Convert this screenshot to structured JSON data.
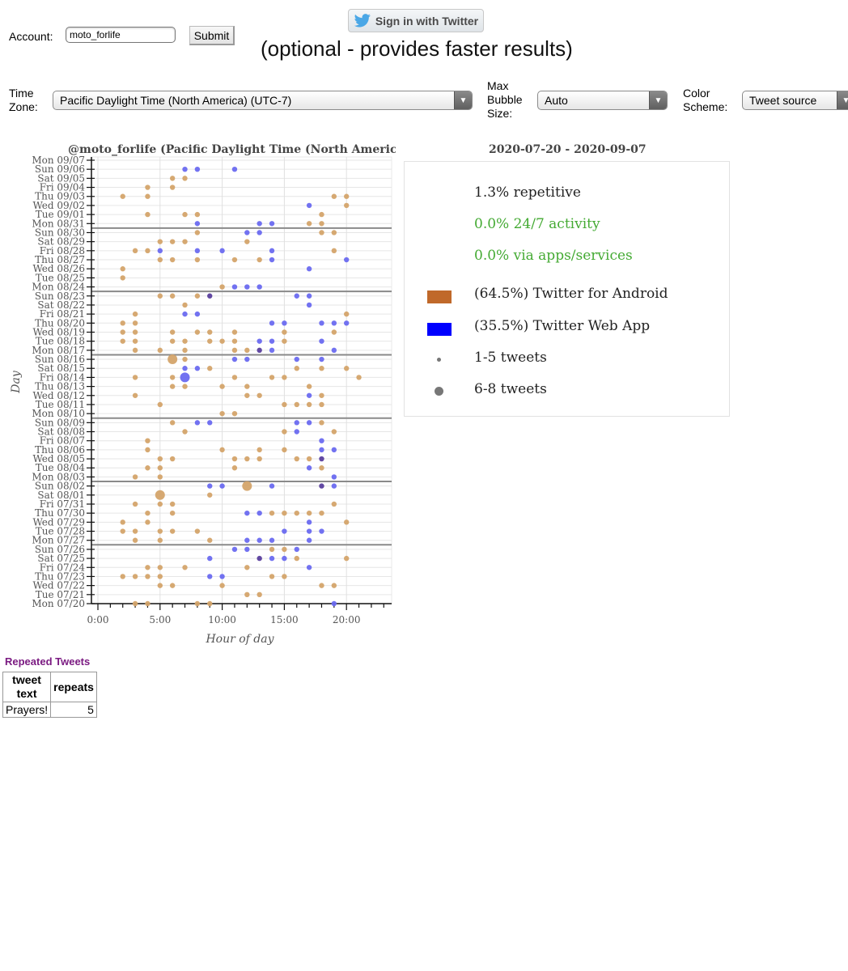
{
  "header": {
    "account_label": "Account:",
    "account_value": "moto_forlife",
    "submit_label": "Submit",
    "twitter_signin_label": "Sign in with Twitter",
    "optional_note": "(optional - provides faster results)"
  },
  "controls": {
    "timezone_label_line1": "Time",
    "timezone_label_line2": "Zone:",
    "timezone_value": "Pacific Daylight Time (North America) (UTC-7)",
    "bubble_label_line1": "Max",
    "bubble_label_line2": "Bubble",
    "bubble_label_line3": "Size:",
    "bubble_value": "Auto",
    "color_label_line1": "Color",
    "color_label_line2": "Scheme:",
    "color_value": "Tweet source"
  },
  "legend": {
    "repetitive": "1.3% repetitive",
    "activity_247": "0.0% 24/7 activity",
    "apps_services": "0.0% via apps/services",
    "source_android": "(64.5%) Twitter for Android",
    "source_web": "(35.5%) Twitter Web App",
    "size_small": "1-5 tweets",
    "size_large": "6-8 tweets",
    "colors": {
      "android": "#c0692a",
      "web": "#0000ff",
      "neutral_text": "#222222",
      "good_text": "#44aa33"
    }
  },
  "repeated": {
    "title": "Repeated Tweets",
    "headers": [
      "tweet text",
      "repeats"
    ],
    "header_text_line1": "tweet",
    "header_text_line2": "text",
    "rows": [
      {
        "text": "Prayers!",
        "repeats": "5"
      }
    ]
  },
  "chart_data": {
    "type": "scatter",
    "title": "@moto_forlife (Pacific Daylight Time (North Americ",
    "date_range": "2020-07-20 - 2020-09-07",
    "xlabel": "Hour of day",
    "ylabel": "Day",
    "xlim": [
      -0.5,
      23.5
    ],
    "x_ticks": [
      0,
      5,
      10,
      15,
      20
    ],
    "x_tick_labels": [
      "0:00",
      "5:00",
      "10:00",
      "15:00",
      "20:00"
    ],
    "grid": true,
    "legend_position": "right",
    "dot_colors": {
      "android": "#d4a46a",
      "web": "#6a6af0",
      "both": "#5a3f9e"
    },
    "days": [
      "Mon 09/07",
      "Sun 09/06",
      "Sat 09/05",
      "Fri 09/04",
      "Thu 09/03",
      "Wed 09/02",
      "Tue 09/01",
      "Mon 08/31",
      "Sun 08/30",
      "Sat 08/29",
      "Fri 08/28",
      "Thu 08/27",
      "Wed 08/26",
      "Tue 08/25",
      "Mon 08/24",
      "Sun 08/23",
      "Sat 08/22",
      "Fri 08/21",
      "Thu 08/20",
      "Wed 08/19",
      "Tue 08/18",
      "Mon 08/17",
      "Sun 08/16",
      "Sat 08/15",
      "Fri 08/14",
      "Thu 08/13",
      "Wed 08/12",
      "Tue 08/11",
      "Mon 08/10",
      "Sun 08/09",
      "Sat 08/08",
      "Fri 08/07",
      "Thu 08/06",
      "Wed 08/05",
      "Tue 08/04",
      "Mon 08/03",
      "Sun 08/02",
      "Sat 08/01",
      "Fri 07/31",
      "Thu 07/30",
      "Wed 07/29",
      "Tue 07/28",
      "Mon 07/27",
      "Sun 07/26",
      "Sat 07/25",
      "Fri 07/24",
      "Thu 07/23",
      "Wed 07/22",
      "Tue 07/21",
      "Mon 07/20"
    ],
    "week_separators_after": [
      "Mon 08/31",
      "Mon 08/24",
      "Mon 08/17",
      "Mon 08/10",
      "Mon 08/03",
      "Mon 07/27"
    ],
    "points": [
      {
        "day": "Sun 09/06",
        "hours": [
          7,
          8,
          11
        ],
        "source": "web"
      },
      {
        "day": "Sat 09/05",
        "hours": [
          6,
          7
        ],
        "source": "android"
      },
      {
        "day": "Fri 09/04",
        "hours": [
          4,
          6
        ],
        "source": "android"
      },
      {
        "day": "Thu 09/03",
        "hours": [
          2,
          4,
          19,
          20
        ],
        "source": "android"
      },
      {
        "day": "Wed 09/02",
        "hours": [
          17
        ],
        "source": "web"
      },
      {
        "day": "Wed 09/02",
        "hours": [
          20
        ],
        "source": "android"
      },
      {
        "day": "Tue 09/01",
        "hours": [
          4,
          7,
          8,
          18
        ],
        "source": "android"
      },
      {
        "day": "Mon 08/31",
        "hours": [
          8,
          13,
          14
        ],
        "source": "web"
      },
      {
        "day": "Mon 08/31",
        "hours": [
          17,
          18
        ],
        "source": "android"
      },
      {
        "day": "Sun 08/30",
        "hours": [
          8,
          18,
          19
        ],
        "source": "android"
      },
      {
        "day": "Sun 08/30",
        "hours": [
          12,
          13
        ],
        "source": "web"
      },
      {
        "day": "Sat 08/29",
        "hours": [
          5,
          6,
          7,
          12
        ],
        "source": "android"
      },
      {
        "day": "Fri 08/28",
        "hours": [
          3,
          4,
          19
        ],
        "source": "android"
      },
      {
        "day": "Fri 08/28",
        "hours": [
          5,
          8,
          10,
          14
        ],
        "source": "web"
      },
      {
        "day": "Thu 08/27",
        "hours": [
          5,
          6,
          8,
          11,
          13
        ],
        "source": "android"
      },
      {
        "day": "Thu 08/27",
        "hours": [
          14,
          20
        ],
        "source": "web"
      },
      {
        "day": "Wed 08/26",
        "hours": [
          2
        ],
        "source": "android"
      },
      {
        "day": "Wed 08/26",
        "hours": [
          17
        ],
        "source": "web"
      },
      {
        "day": "Tue 08/25",
        "hours": [
          2
        ],
        "source": "android"
      },
      {
        "day": "Mon 08/24",
        "hours": [
          10
        ],
        "source": "android"
      },
      {
        "day": "Mon 08/24",
        "hours": [
          11,
          12,
          13
        ],
        "source": "web"
      },
      {
        "day": "Sun 08/23",
        "hours": [
          5,
          6,
          8
        ],
        "source": "android"
      },
      {
        "day": "Sun 08/23",
        "hours": [
          9
        ],
        "source": "both"
      },
      {
        "day": "Sun 08/23",
        "hours": [
          16,
          17
        ],
        "source": "web"
      },
      {
        "day": "Sat 08/22",
        "hours": [
          7
        ],
        "source": "android"
      },
      {
        "day": "Sat 08/22",
        "hours": [
          17
        ],
        "source": "web"
      },
      {
        "day": "Fri 08/21",
        "hours": [
          3,
          20
        ],
        "source": "android"
      },
      {
        "day": "Fri 08/21",
        "hours": [
          7,
          8
        ],
        "source": "web"
      },
      {
        "day": "Thu 08/20",
        "hours": [
          2,
          3
        ],
        "source": "android"
      },
      {
        "day": "Thu 08/20",
        "hours": [
          14,
          15,
          18,
          19,
          20
        ],
        "source": "web"
      },
      {
        "day": "Wed 08/19",
        "hours": [
          2,
          3,
          6,
          8,
          9,
          11,
          15,
          19
        ],
        "source": "android"
      },
      {
        "day": "Tue 08/18",
        "hours": [
          2,
          3,
          6,
          7,
          9,
          10,
          11,
          15
        ],
        "source": "android"
      },
      {
        "day": "Tue 08/18",
        "hours": [
          13,
          14,
          18
        ],
        "source": "web"
      },
      {
        "day": "Mon 08/17",
        "hours": [
          3,
          5,
          7,
          11,
          12
        ],
        "source": "android"
      },
      {
        "day": "Mon 08/17",
        "hours": [
          13
        ],
        "source": "both"
      },
      {
        "day": "Mon 08/17",
        "hours": [
          14,
          19
        ],
        "source": "web"
      },
      {
        "day": "Sun 08/16",
        "hours": [
          6
        ],
        "source": "android",
        "size": "large"
      },
      {
        "day": "Sun 08/16",
        "hours": [
          7
        ],
        "source": "android"
      },
      {
        "day": "Sun 08/16",
        "hours": [
          11,
          12,
          16,
          18
        ],
        "source": "web"
      },
      {
        "day": "Sat 08/15",
        "hours": [
          7,
          8
        ],
        "source": "web"
      },
      {
        "day": "Sat 08/15",
        "hours": [
          9,
          16,
          18,
          20
        ],
        "source": "android"
      },
      {
        "day": "Fri 08/14",
        "hours": [
          3,
          6,
          11,
          14,
          15,
          21
        ],
        "source": "android"
      },
      {
        "day": "Fri 08/14",
        "hours": [
          7
        ],
        "source": "web",
        "size": "large"
      },
      {
        "day": "Thu 08/13",
        "hours": [
          6,
          7,
          10,
          12,
          17
        ],
        "source": "android"
      },
      {
        "day": "Wed 08/12",
        "hours": [
          3,
          12,
          13,
          18
        ],
        "source": "android"
      },
      {
        "day": "Wed 08/12",
        "hours": [
          17
        ],
        "source": "web"
      },
      {
        "day": "Tue 08/11",
        "hours": [
          5,
          15,
          16,
          17,
          18
        ],
        "source": "android"
      },
      {
        "day": "Mon 08/10",
        "hours": [
          10,
          11
        ],
        "source": "android"
      },
      {
        "day": "Sun 08/09",
        "hours": [
          6,
          18
        ],
        "source": "android"
      },
      {
        "day": "Sun 08/09",
        "hours": [
          8,
          9,
          16,
          17
        ],
        "source": "web"
      },
      {
        "day": "Sat 08/08",
        "hours": [
          7,
          15,
          19
        ],
        "source": "android"
      },
      {
        "day": "Sat 08/08",
        "hours": [
          16
        ],
        "source": "web"
      },
      {
        "day": "Fri 08/07",
        "hours": [
          4
        ],
        "source": "android"
      },
      {
        "day": "Fri 08/07",
        "hours": [
          18
        ],
        "source": "web"
      },
      {
        "day": "Thu 08/06",
        "hours": [
          4,
          10,
          13,
          15
        ],
        "source": "android"
      },
      {
        "day": "Thu 08/06",
        "hours": [
          18,
          19
        ],
        "source": "web"
      },
      {
        "day": "Wed 08/05",
        "hours": [
          5,
          6,
          11,
          12,
          13,
          16,
          17
        ],
        "source": "android"
      },
      {
        "day": "Wed 08/05",
        "hours": [
          18
        ],
        "source": "both"
      },
      {
        "day": "Tue 08/04",
        "hours": [
          4,
          5,
          11,
          18
        ],
        "source": "android"
      },
      {
        "day": "Tue 08/04",
        "hours": [
          17
        ],
        "source": "web"
      },
      {
        "day": "Mon 08/03",
        "hours": [
          3,
          5
        ],
        "source": "android"
      },
      {
        "day": "Mon 08/03",
        "hours": [
          19
        ],
        "source": "web"
      },
      {
        "day": "Sun 08/02",
        "hours": [
          9,
          10,
          14,
          19
        ],
        "source": "web"
      },
      {
        "day": "Sun 08/02",
        "hours": [
          12
        ],
        "source": "android",
        "size": "large"
      },
      {
        "day": "Sun 08/02",
        "hours": [
          18
        ],
        "source": "both"
      },
      {
        "day": "Sat 08/01",
        "hours": [
          5
        ],
        "source": "android",
        "size": "large"
      },
      {
        "day": "Sat 08/01",
        "hours": [
          9
        ],
        "source": "android"
      },
      {
        "day": "Fri 07/31",
        "hours": [
          3,
          5,
          6,
          19
        ],
        "source": "android"
      },
      {
        "day": "Thu 07/30",
        "hours": [
          4,
          6,
          14,
          15,
          16,
          17,
          18
        ],
        "source": "android"
      },
      {
        "day": "Thu 07/30",
        "hours": [
          12,
          13
        ],
        "source": "web"
      },
      {
        "day": "Wed 07/29",
        "hours": [
          2,
          4,
          20
        ],
        "source": "android"
      },
      {
        "day": "Wed 07/29",
        "hours": [
          17
        ],
        "source": "web"
      },
      {
        "day": "Tue 07/28",
        "hours": [
          2,
          3,
          5,
          6,
          8
        ],
        "source": "android"
      },
      {
        "day": "Tue 07/28",
        "hours": [
          15,
          17,
          18
        ],
        "source": "web"
      },
      {
        "day": "Mon 07/27",
        "hours": [
          3,
          5,
          9
        ],
        "source": "android"
      },
      {
        "day": "Mon 07/27",
        "hours": [
          12,
          13,
          14,
          17
        ],
        "source": "web"
      },
      {
        "day": "Sun 07/26",
        "hours": [
          11,
          12,
          16
        ],
        "source": "web"
      },
      {
        "day": "Sun 07/26",
        "hours": [
          14,
          15
        ],
        "source": "android"
      },
      {
        "day": "Sat 07/25",
        "hours": [
          9,
          14,
          15
        ],
        "source": "web"
      },
      {
        "day": "Sat 07/25",
        "hours": [
          13
        ],
        "source": "both"
      },
      {
        "day": "Sat 07/25",
        "hours": [
          16,
          20
        ],
        "source": "android"
      },
      {
        "day": "Fri 07/24",
        "hours": [
          4,
          5,
          7,
          12
        ],
        "source": "android"
      },
      {
        "day": "Fri 07/24",
        "hours": [
          17
        ],
        "source": "web"
      },
      {
        "day": "Thu 07/23",
        "hours": [
          2,
          3,
          4,
          5,
          14,
          15
        ],
        "source": "android"
      },
      {
        "day": "Thu 07/23",
        "hours": [
          9,
          10
        ],
        "source": "web"
      },
      {
        "day": "Wed 07/22",
        "hours": [
          5,
          6,
          10,
          18,
          19
        ],
        "source": "android"
      },
      {
        "day": "Tue 07/21",
        "hours": [
          12,
          13
        ],
        "source": "android"
      },
      {
        "day": "Mon 07/20",
        "hours": [
          3,
          4,
          8,
          9
        ],
        "source": "android"
      },
      {
        "day": "Mon 07/20",
        "hours": [
          19
        ],
        "source": "web"
      }
    ]
  }
}
